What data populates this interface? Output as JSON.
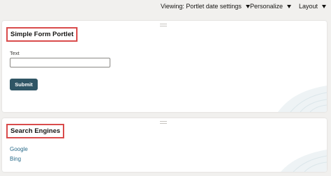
{
  "topbar": {
    "viewing_label": "Viewing: Portlet date settings",
    "personalize_label": "Personalize",
    "layout_label": "Layout"
  },
  "portlets": {
    "form": {
      "title": "Simple Form Portlet",
      "field_label": "Text",
      "field_value": "",
      "submit_label": "Submit"
    },
    "search": {
      "title": "Search Engines",
      "links": [
        "Google",
        "Bing"
      ]
    }
  },
  "colors": {
    "highlight_border": "#d94b4b",
    "button": "#2f5565",
    "link": "#2a6b8a",
    "page_background": "#f1f0ee"
  },
  "icons": [
    "caret-down-icon",
    "drag-handle-icon"
  ]
}
